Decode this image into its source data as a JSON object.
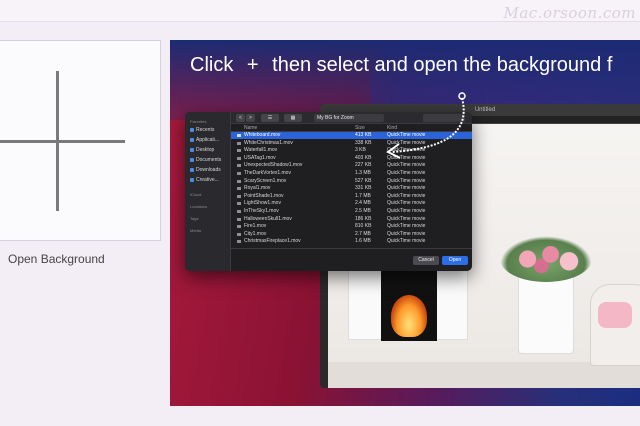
{
  "watermark": "Mac.orsoon.com",
  "open_background": {
    "label": "Open Background",
    "icon": "plus-icon"
  },
  "tutorial": {
    "instruction_prefix": "Click",
    "plus_glyph": "+",
    "instruction_suffix": "then select and open the background f",
    "photo_window_title": "Untitled"
  },
  "dialog": {
    "sidebar": {
      "favorites_heading": "Favorites",
      "items": [
        "Recents",
        "Applicati...",
        "Desktop",
        "Documents",
        "Downloads",
        "Creative..."
      ],
      "icloud_heading": "iCloud",
      "locations_heading": "Locations",
      "tags_heading": "Tags",
      "media_heading": "Media"
    },
    "toolbar": {
      "back": "<",
      "forward": ">",
      "view": "☰",
      "group": "▦",
      "location": "My BG for Zoom"
    },
    "columns": {
      "name": "Name",
      "size": "Size",
      "kind": "Kind"
    },
    "files": [
      {
        "name": "Whiteboard.mov",
        "size": "413 KB",
        "kind": "QuickTime movie",
        "selected": true
      },
      {
        "name": "WhiteChristmas1.mov",
        "size": "338 KB",
        "kind": "QuickTime movie",
        "selected": false
      },
      {
        "name": "Waterfall1.mov",
        "size": "3 KB",
        "kind": "QuickTime movie",
        "selected": false
      },
      {
        "name": "USATag1.mov",
        "size": "403 KB",
        "kind": "QuickTime movie",
        "selected": false
      },
      {
        "name": "UnexpectedShadow1.mov",
        "size": "227 KB",
        "kind": "QuickTime movie",
        "selected": false
      },
      {
        "name": "TheDarkVortex1.mov",
        "size": "1.3 MB",
        "kind": "QuickTime movie",
        "selected": false
      },
      {
        "name": "ScaryScreen1.mov",
        "size": "527 KB",
        "kind": "QuickTime movie",
        "selected": false
      },
      {
        "name": "Royal1.mov",
        "size": "331 KB",
        "kind": "QuickTime movie",
        "selected": false
      },
      {
        "name": "PointShade1.mov",
        "size": "1.7 MB",
        "kind": "QuickTime movie",
        "selected": false
      },
      {
        "name": "LightShow1.mov",
        "size": "2.4 MB",
        "kind": "QuickTime movie",
        "selected": false
      },
      {
        "name": "InTheSky1.mov",
        "size": "2.5 MB",
        "kind": "QuickTime movie",
        "selected": false
      },
      {
        "name": "HalloweenSkull1.mov",
        "size": "186 KB",
        "kind": "QuickTime movie",
        "selected": false
      },
      {
        "name": "Fire1.mov",
        "size": "810 KB",
        "kind": "QuickTime movie",
        "selected": false
      },
      {
        "name": "City1.mov",
        "size": "2.7 MB",
        "kind": "QuickTime movie",
        "selected": false
      },
      {
        "name": "ChristmasFireplace1.mov",
        "size": "1.6 MB",
        "kind": "QuickTime movie",
        "selected": false
      }
    ],
    "cancel_label": "Cancel",
    "open_label": "Open"
  },
  "colors": {
    "selection": "#2b63d9",
    "open_button": "#2b6ee8",
    "dialog_bg": "#1f1f22"
  }
}
